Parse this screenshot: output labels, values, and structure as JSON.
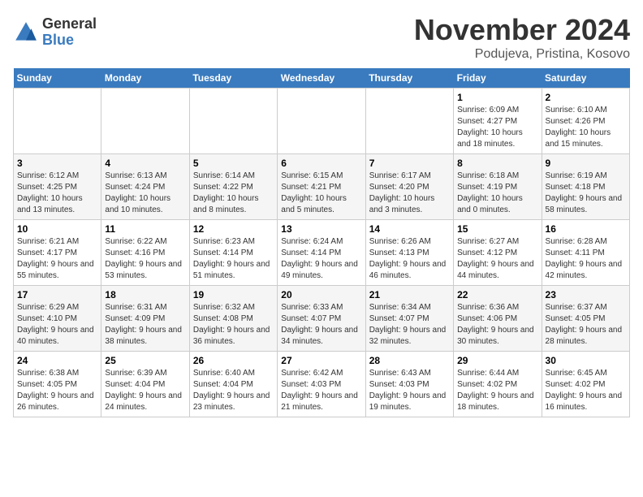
{
  "logo": {
    "general": "General",
    "blue": "Blue"
  },
  "header": {
    "month": "November 2024",
    "location": "Podujeva, Pristina, Kosovo"
  },
  "weekdays": [
    "Sunday",
    "Monday",
    "Tuesday",
    "Wednesday",
    "Thursday",
    "Friday",
    "Saturday"
  ],
  "weeks": [
    [
      {
        "day": "",
        "info": ""
      },
      {
        "day": "",
        "info": ""
      },
      {
        "day": "",
        "info": ""
      },
      {
        "day": "",
        "info": ""
      },
      {
        "day": "",
        "info": ""
      },
      {
        "day": "1",
        "info": "Sunrise: 6:09 AM\nSunset: 4:27 PM\nDaylight: 10 hours and 18 minutes."
      },
      {
        "day": "2",
        "info": "Sunrise: 6:10 AM\nSunset: 4:26 PM\nDaylight: 10 hours and 15 minutes."
      }
    ],
    [
      {
        "day": "3",
        "info": "Sunrise: 6:12 AM\nSunset: 4:25 PM\nDaylight: 10 hours and 13 minutes."
      },
      {
        "day": "4",
        "info": "Sunrise: 6:13 AM\nSunset: 4:24 PM\nDaylight: 10 hours and 10 minutes."
      },
      {
        "day": "5",
        "info": "Sunrise: 6:14 AM\nSunset: 4:22 PM\nDaylight: 10 hours and 8 minutes."
      },
      {
        "day": "6",
        "info": "Sunrise: 6:15 AM\nSunset: 4:21 PM\nDaylight: 10 hours and 5 minutes."
      },
      {
        "day": "7",
        "info": "Sunrise: 6:17 AM\nSunset: 4:20 PM\nDaylight: 10 hours and 3 minutes."
      },
      {
        "day": "8",
        "info": "Sunrise: 6:18 AM\nSunset: 4:19 PM\nDaylight: 10 hours and 0 minutes."
      },
      {
        "day": "9",
        "info": "Sunrise: 6:19 AM\nSunset: 4:18 PM\nDaylight: 9 hours and 58 minutes."
      }
    ],
    [
      {
        "day": "10",
        "info": "Sunrise: 6:21 AM\nSunset: 4:17 PM\nDaylight: 9 hours and 55 minutes."
      },
      {
        "day": "11",
        "info": "Sunrise: 6:22 AM\nSunset: 4:16 PM\nDaylight: 9 hours and 53 minutes."
      },
      {
        "day": "12",
        "info": "Sunrise: 6:23 AM\nSunset: 4:14 PM\nDaylight: 9 hours and 51 minutes."
      },
      {
        "day": "13",
        "info": "Sunrise: 6:24 AM\nSunset: 4:14 PM\nDaylight: 9 hours and 49 minutes."
      },
      {
        "day": "14",
        "info": "Sunrise: 6:26 AM\nSunset: 4:13 PM\nDaylight: 9 hours and 46 minutes."
      },
      {
        "day": "15",
        "info": "Sunrise: 6:27 AM\nSunset: 4:12 PM\nDaylight: 9 hours and 44 minutes."
      },
      {
        "day": "16",
        "info": "Sunrise: 6:28 AM\nSunset: 4:11 PM\nDaylight: 9 hours and 42 minutes."
      }
    ],
    [
      {
        "day": "17",
        "info": "Sunrise: 6:29 AM\nSunset: 4:10 PM\nDaylight: 9 hours and 40 minutes."
      },
      {
        "day": "18",
        "info": "Sunrise: 6:31 AM\nSunset: 4:09 PM\nDaylight: 9 hours and 38 minutes."
      },
      {
        "day": "19",
        "info": "Sunrise: 6:32 AM\nSunset: 4:08 PM\nDaylight: 9 hours and 36 minutes."
      },
      {
        "day": "20",
        "info": "Sunrise: 6:33 AM\nSunset: 4:07 PM\nDaylight: 9 hours and 34 minutes."
      },
      {
        "day": "21",
        "info": "Sunrise: 6:34 AM\nSunset: 4:07 PM\nDaylight: 9 hours and 32 minutes."
      },
      {
        "day": "22",
        "info": "Sunrise: 6:36 AM\nSunset: 4:06 PM\nDaylight: 9 hours and 30 minutes."
      },
      {
        "day": "23",
        "info": "Sunrise: 6:37 AM\nSunset: 4:05 PM\nDaylight: 9 hours and 28 minutes."
      }
    ],
    [
      {
        "day": "24",
        "info": "Sunrise: 6:38 AM\nSunset: 4:05 PM\nDaylight: 9 hours and 26 minutes."
      },
      {
        "day": "25",
        "info": "Sunrise: 6:39 AM\nSunset: 4:04 PM\nDaylight: 9 hours and 24 minutes."
      },
      {
        "day": "26",
        "info": "Sunrise: 6:40 AM\nSunset: 4:04 PM\nDaylight: 9 hours and 23 minutes."
      },
      {
        "day": "27",
        "info": "Sunrise: 6:42 AM\nSunset: 4:03 PM\nDaylight: 9 hours and 21 minutes."
      },
      {
        "day": "28",
        "info": "Sunrise: 6:43 AM\nSunset: 4:03 PM\nDaylight: 9 hours and 19 minutes."
      },
      {
        "day": "29",
        "info": "Sunrise: 6:44 AM\nSunset: 4:02 PM\nDaylight: 9 hours and 18 minutes."
      },
      {
        "day": "30",
        "info": "Sunrise: 6:45 AM\nSunset: 4:02 PM\nDaylight: 9 hours and 16 minutes."
      }
    ]
  ]
}
